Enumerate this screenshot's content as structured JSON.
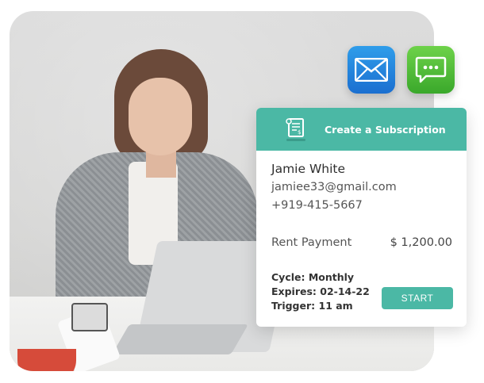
{
  "card": {
    "title": "Create a Subscription",
    "contact": {
      "name": "Jamie White",
      "email": "jamiee33@gmail.com",
      "phone": "+919-415-5667"
    },
    "payment": {
      "label": "Rent Payment",
      "amount": "$ 1,200.00"
    },
    "details": {
      "cycle": "Cycle: Monthly",
      "expires": "Expires: 02-14-22",
      "trigger": "Trigger: 11 am"
    },
    "start_label": "START"
  },
  "icons": {
    "mail": "mail-icon",
    "chat": "chat-icon",
    "subscription": "subscription-document-icon"
  },
  "colors": {
    "accent": "#4bb8a5",
    "mail_blue": "#1b6fd0",
    "chat_green": "#3aa82b"
  }
}
